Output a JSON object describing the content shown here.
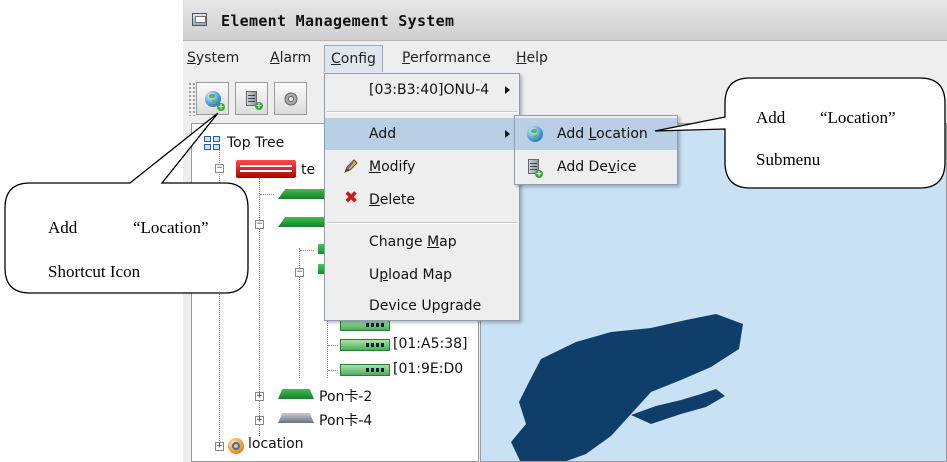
{
  "window": {
    "title": "Element Management System"
  },
  "menubar": {
    "items": [
      {
        "label": "System",
        "mnemonic": "S",
        "rest": "ystem"
      },
      {
        "label": "Alarm",
        "mnemonic": "A",
        "rest": "larm"
      },
      {
        "label": "Config",
        "mnemonic": "C",
        "rest": "onfig"
      },
      {
        "label": "Performance",
        "mnemonic": "P",
        "rest": "erformance"
      },
      {
        "label": "Help",
        "mnemonic": "H",
        "rest": "elp"
      }
    ]
  },
  "toolbar": {
    "icons": [
      "add-location-icon",
      "add-device-icon",
      "settings-icon"
    ]
  },
  "tree": {
    "root": "Top Tree",
    "device_name_partial": "te",
    "onu_rows": [
      "[01:A5:38]",
      "[01:9E:D0"
    ],
    "pon_cards": [
      "Pon卡-2",
      "Pon卡-4"
    ],
    "location": "location"
  },
  "config_menu": {
    "items": [
      {
        "label": "[03:B3:40]ONU-4",
        "has_submenu": true
      },
      {
        "label": "Add",
        "has_submenu": true,
        "highlighted": true
      },
      {
        "label": "Modify",
        "mnemonic": "M",
        "rest": "odify",
        "icon": "pencil-icon"
      },
      {
        "label": "Delete",
        "mnemonic": "D",
        "rest": "elete",
        "icon": "delete-icon"
      },
      {
        "label": "Change Map",
        "pre": "Change ",
        "mnemonic": "M",
        "rest": "ap"
      },
      {
        "label": "Upload Map",
        "pre": "U",
        "mnemonic": "p",
        "rest": "load Map"
      },
      {
        "label": "Device Upgrade"
      }
    ]
  },
  "add_submenu": {
    "items": [
      {
        "label": "Add Location",
        "pre": "Add ",
        "mnemonic": "L",
        "rest": "ocation",
        "icon": "add-location-icon",
        "highlighted": true
      },
      {
        "label": "Add Device",
        "pre": "Add De",
        "mnemonic": "v",
        "rest": "ice",
        "icon": "add-device-icon"
      }
    ]
  },
  "callouts": {
    "shortcut": {
      "line1_a": "Add",
      "line1_b": "“Location”",
      "line2": "Shortcut Icon"
    },
    "submenu": {
      "line1_a": "Add",
      "line1_b": "“Location”",
      "line2": "Submenu"
    }
  },
  "colors": {
    "menu_highlight": "#b8cfe6",
    "map_sea": "#c9e1f4",
    "map_land": "#0f3e6b"
  }
}
